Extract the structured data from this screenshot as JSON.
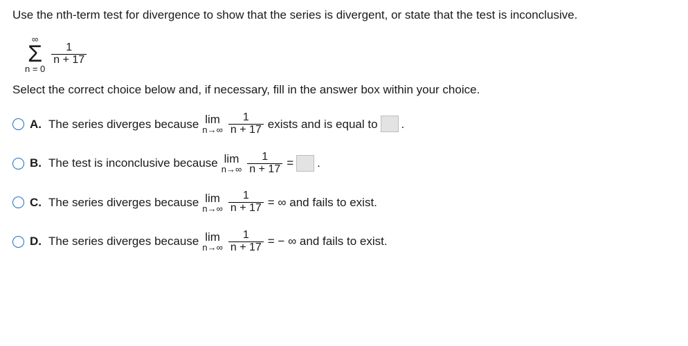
{
  "prompt": "Use the nth-term test for divergence to show that the series is divergent, or state that the test is inconclusive.",
  "series": {
    "upper": "∞",
    "lower": "n = 0",
    "num": "1",
    "den": "n + 17"
  },
  "instruction": "Select the correct choice below and, if necessary, fill in the answer box within your choice.",
  "frac": {
    "num": "1",
    "den": "n + 17"
  },
  "lim": {
    "top": "lim",
    "bot": "n→∞"
  },
  "A": {
    "label": "A.",
    "pre": "The series diverges because",
    "mid": "exists and is equal to",
    "post": "."
  },
  "B": {
    "label": "B.",
    "pre": "The test is inconclusive because",
    "eq": "=",
    "post": "."
  },
  "C": {
    "label": "C.",
    "pre": "The series diverges because",
    "post": "= ∞ and fails to exist."
  },
  "D": {
    "label": "D.",
    "pre": "The series diverges because",
    "post": "= − ∞ and fails to exist."
  }
}
